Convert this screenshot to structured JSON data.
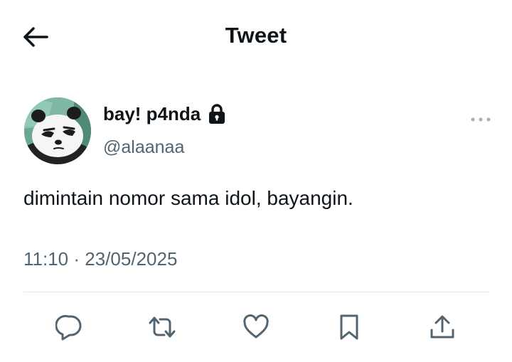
{
  "header": {
    "title": "Tweet",
    "back_icon": "arrow-left-icon"
  },
  "author": {
    "display_name": "bay! p4nda",
    "handle": "@alaanaa",
    "protected_icon": "lock-icon",
    "avatar": "panda-avatar"
  },
  "tweet": {
    "text": "dimintain nomor sama idol, bayangin.",
    "time": "11:10",
    "separator": "·",
    "date": "23/05/2025"
  },
  "actions": [
    {
      "name": "reply",
      "icon": "reply-icon"
    },
    {
      "name": "retweet",
      "icon": "retweet-icon"
    },
    {
      "name": "like",
      "icon": "heart-icon"
    },
    {
      "name": "bookmark",
      "icon": "bookmark-icon"
    },
    {
      "name": "share",
      "icon": "share-icon"
    }
  ],
  "colors": {
    "text": "#0f1419",
    "secondary": "#536471",
    "icon": "#536471",
    "divider": "#e1e6ea"
  }
}
